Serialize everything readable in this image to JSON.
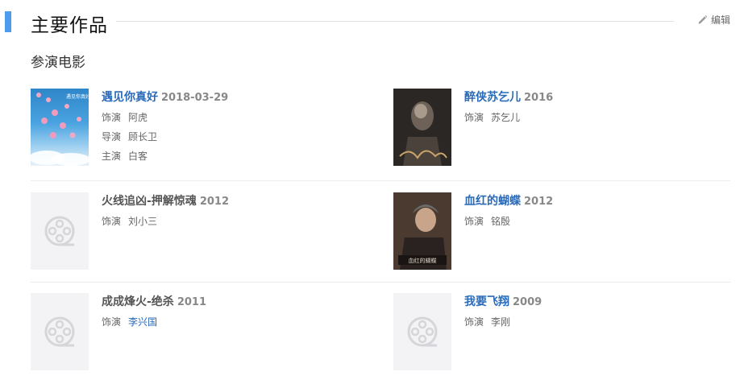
{
  "header": {
    "title": "主要作品",
    "edit_label": "编辑"
  },
  "section": {
    "title": "参演电影"
  },
  "films": [
    {
      "title": "遇见你真好",
      "year": "2018-03-29",
      "title_link": true,
      "poster": "poster-meet-you",
      "roles": [
        {
          "type": "饰演",
          "name": "阿虎"
        },
        {
          "type": "导演",
          "name": "顾长卫"
        },
        {
          "type": "主演",
          "name": "白客"
        }
      ]
    },
    {
      "title": "醉侠苏乞儿",
      "year": "2016",
      "title_link": true,
      "poster": "poster-drunk-hero",
      "roles": [
        {
          "type": "饰演",
          "name": "苏乞儿"
        }
      ]
    },
    {
      "title": "火线追凶-押解惊魂",
      "year": "2012",
      "title_link": false,
      "poster": "film-reel-placeholder",
      "roles": [
        {
          "type": "饰演",
          "name": "刘小三"
        }
      ]
    },
    {
      "title": "血红的蝴蝶",
      "year": "2012",
      "title_link": true,
      "poster": "poster-red-butterfly",
      "roles": [
        {
          "type": "饰演",
          "name": "铭殷"
        }
      ]
    },
    {
      "title": "成成烽火-绝杀",
      "year": "2011",
      "title_link": false,
      "poster": "film-reel-placeholder",
      "roles": [
        {
          "type": "饰演",
          "name": "李兴国",
          "link": true
        }
      ]
    },
    {
      "title": "我要飞翔",
      "year": "2009",
      "title_link": true,
      "poster": "film-reel-placeholder",
      "roles": [
        {
          "type": "饰演",
          "name": "李刚"
        }
      ]
    }
  ],
  "posters": {
    "poster_1_text": "遇见你真好",
    "poster_4_text": "血红的蝴蝶"
  }
}
